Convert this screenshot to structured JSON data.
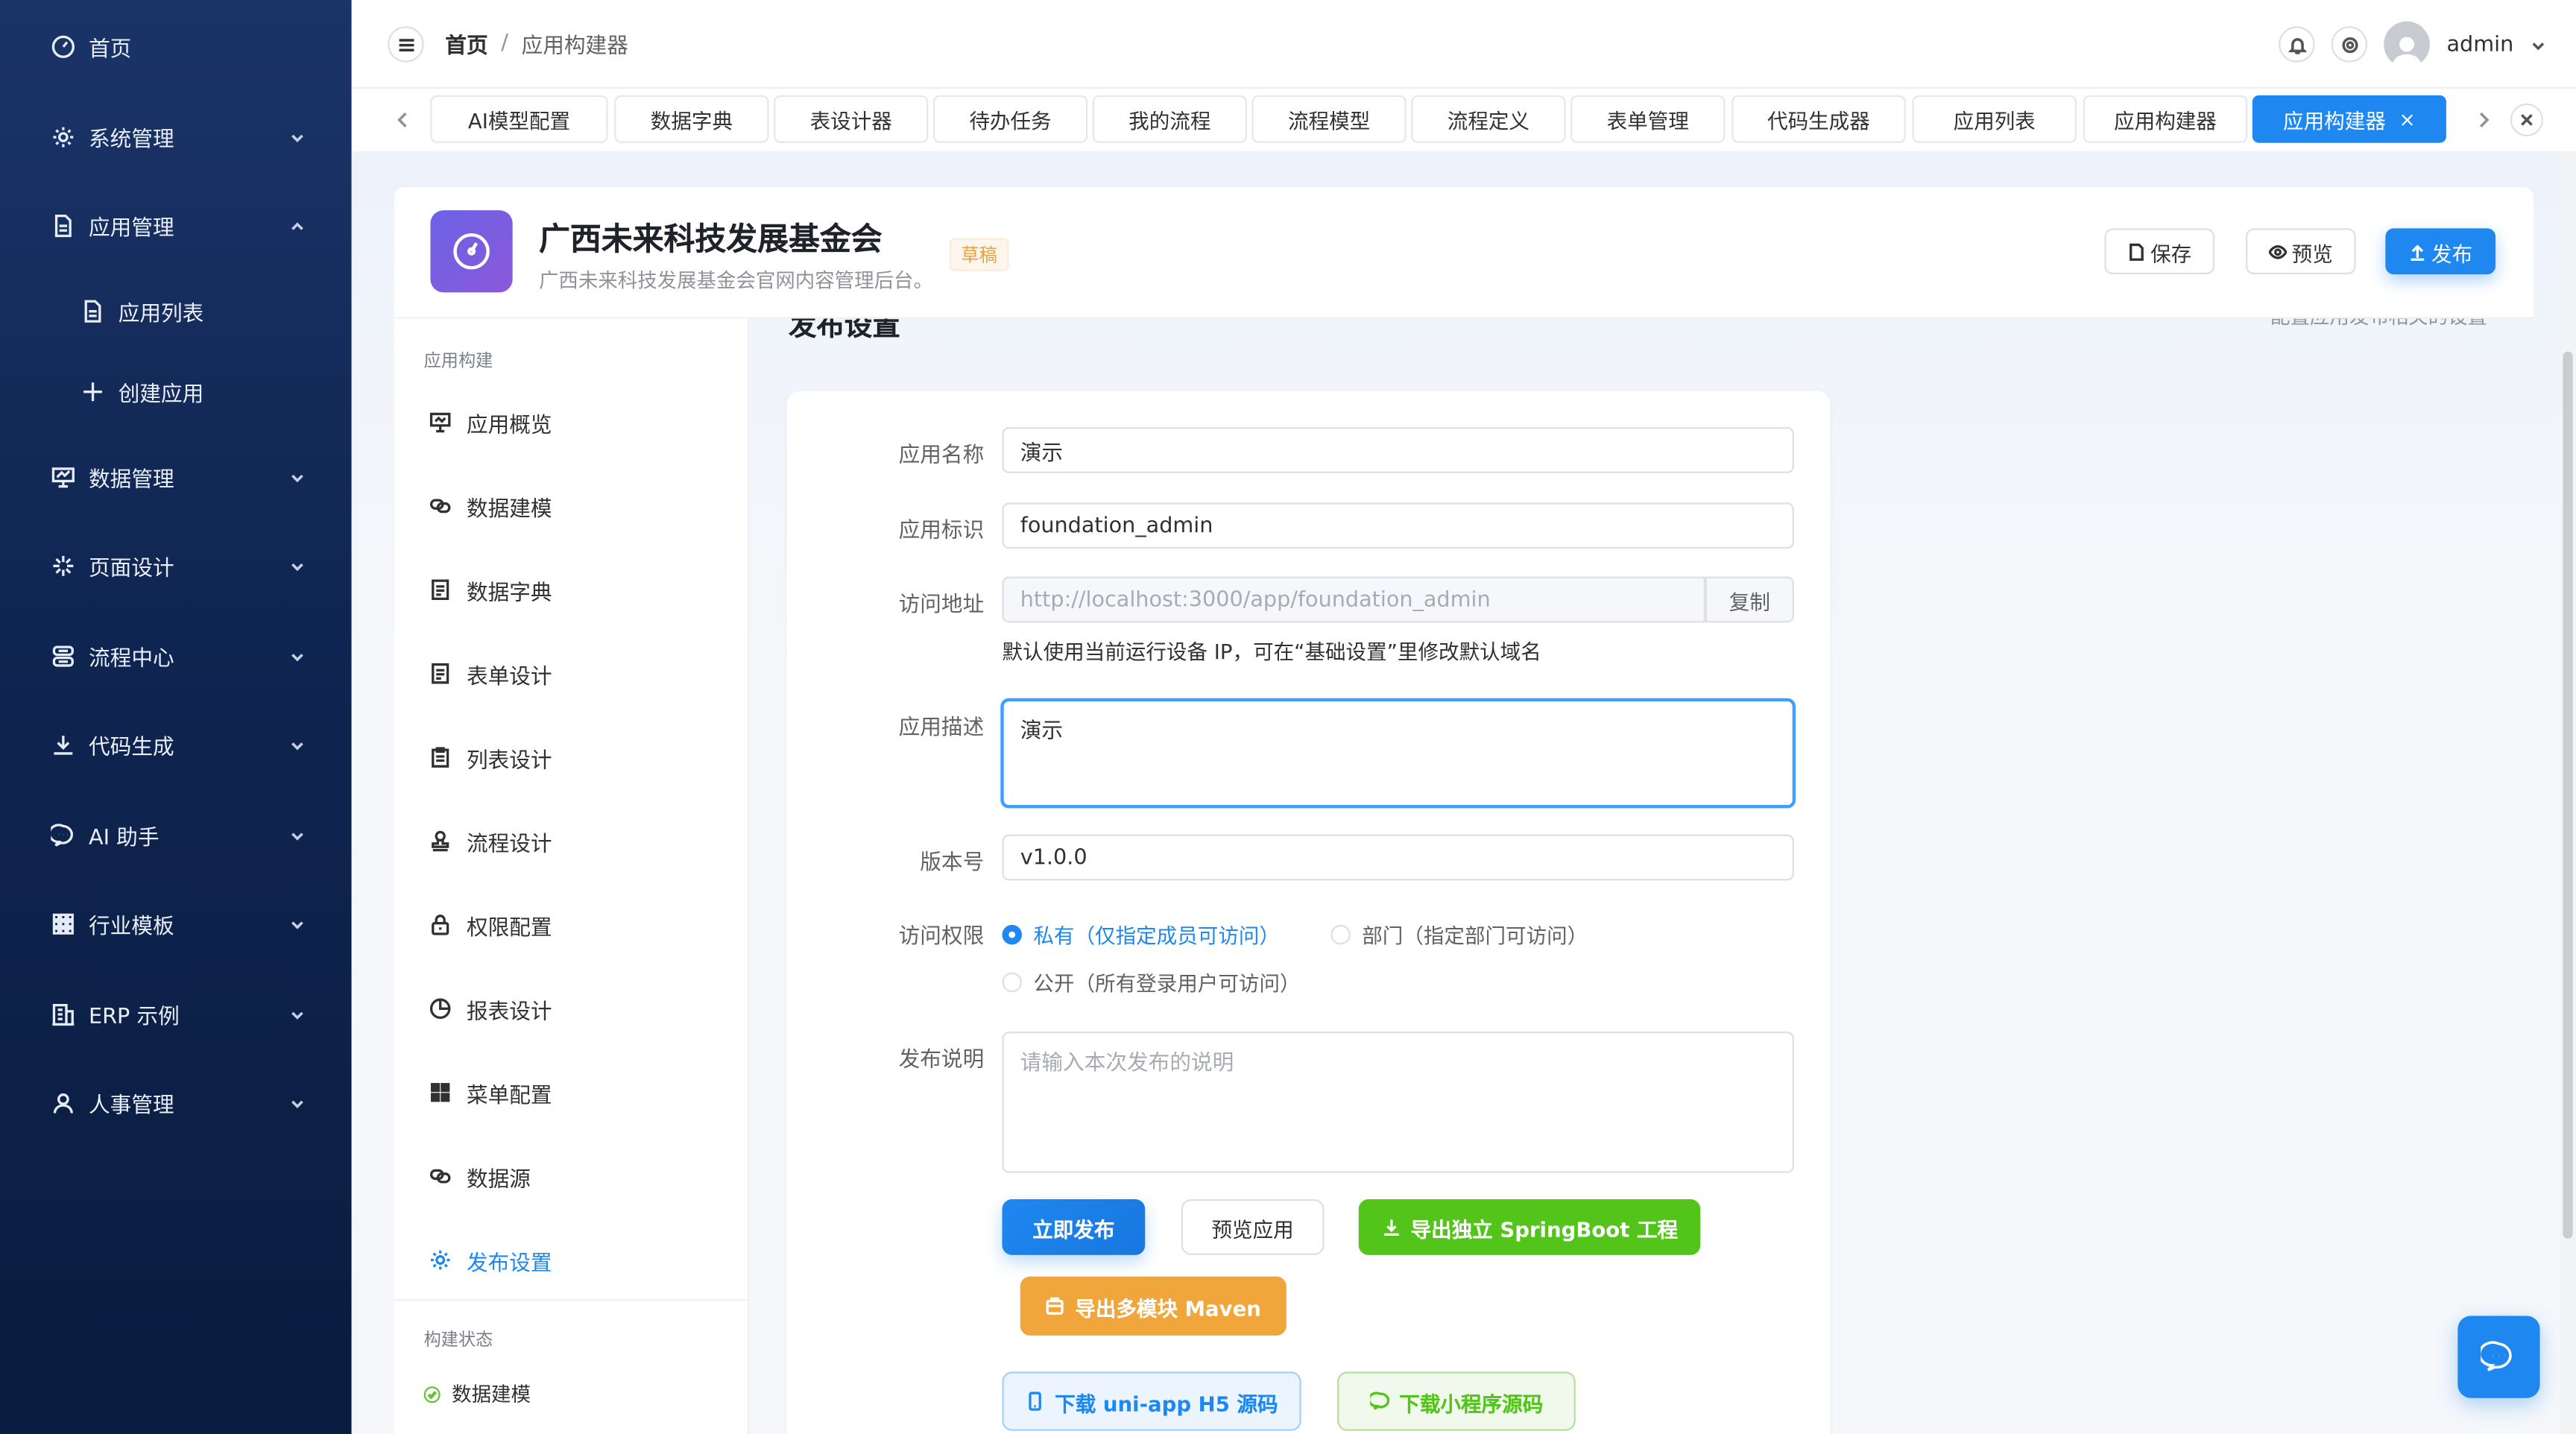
{
  "sidebar": {
    "items": [
      {
        "label": "首页",
        "icon": "dashboard-icon"
      },
      {
        "label": "系统管理",
        "icon": "gear-icon"
      },
      {
        "label": "应用管理",
        "icon": "document-icon"
      },
      {
        "label": "应用列表",
        "icon": "document-icon"
      },
      {
        "label": "创建应用",
        "icon": "plus-icon"
      },
      {
        "label": "数据管理",
        "icon": "chart-board-icon"
      },
      {
        "label": "页面设计",
        "icon": "spark-icon"
      },
      {
        "label": "流程中心",
        "icon": "flow-icon"
      },
      {
        "label": "代码生成",
        "icon": "download-icon"
      },
      {
        "label": "AI 助手",
        "icon": "chat-icon"
      },
      {
        "label": "行业模板",
        "icon": "grid-icon"
      },
      {
        "label": "ERP 示例",
        "icon": "building-icon"
      },
      {
        "label": "人事管理",
        "icon": "user-icon"
      }
    ]
  },
  "header": {
    "breadcrumb_home": "首页",
    "breadcrumb_sep": "/",
    "breadcrumb_current": "应用构建器",
    "username": "admin"
  },
  "tabs": [
    {
      "label": "AI模型配置"
    },
    {
      "label": "数据字典"
    },
    {
      "label": "表设计器"
    },
    {
      "label": "待办任务"
    },
    {
      "label": "我的流程"
    },
    {
      "label": "流程模型"
    },
    {
      "label": "流程定义"
    },
    {
      "label": "表单管理"
    },
    {
      "label": "代码生成器"
    },
    {
      "label": "应用列表"
    },
    {
      "label": "应用构建器"
    },
    {
      "label": "应用构建器",
      "active": true,
      "close": "×"
    }
  ],
  "app": {
    "name": "广西未来科技发展基金会",
    "description": "广西未来科技发展基金会官网内容管理后台。",
    "badge": "草稿",
    "save_label": "保存",
    "preview_label": "预览",
    "publish_label": "发布"
  },
  "builder_nav": {
    "section_label": "应用构建",
    "items": [
      {
        "label": "应用概览",
        "icon": "presentation-icon"
      },
      {
        "label": "数据建模",
        "icon": "link-icon"
      },
      {
        "label": "数据字典",
        "icon": "doc-list-icon"
      },
      {
        "label": "表单设计",
        "icon": "doc-list-icon"
      },
      {
        "label": "列表设计",
        "icon": "clipboard-icon"
      },
      {
        "label": "流程设计",
        "icon": "stamp-icon"
      },
      {
        "label": "权限配置",
        "icon": "lock-icon"
      },
      {
        "label": "报表设计",
        "icon": "pie-icon"
      },
      {
        "label": "菜单配置",
        "icon": "grid-icon"
      },
      {
        "label": "数据源",
        "icon": "link-icon"
      },
      {
        "label": "发布设置",
        "icon": "gear-icon",
        "active": true
      }
    ],
    "status_label": "构建状态",
    "status_items": [
      {
        "label": "数据建模",
        "done": true
      }
    ]
  },
  "page": {
    "title": "发布设置",
    "hint": "配置应用发布相关的设置"
  },
  "form": {
    "name_label": "应用名称",
    "name_value": "演示",
    "code_label": "应用标识",
    "code_value": "foundation_admin",
    "url_label": "访问地址",
    "url_value": "http://localhost:3000/app/foundation_admin",
    "copy_label": "复制",
    "url_help": "默认使用当前运行设备 IP，可在“基础设置”里修改默认域名",
    "desc_label": "应用描述",
    "desc_value": "演示",
    "version_label": "版本号",
    "version_value": "v1.0.0",
    "access_label": "访问权限",
    "access_options": [
      {
        "label": "私有（仅指定成员可访问）",
        "checked": true
      },
      {
        "label": "部门（指定部门可访问）",
        "checked": false
      },
      {
        "label": "公开（所有登录用户可访问）",
        "checked": false
      }
    ],
    "notes_label": "发布说明",
    "notes_placeholder": "请输入本次发布的说明"
  },
  "actions": {
    "publish_now": "立即发布",
    "preview_app": "预览应用",
    "export_springboot": "导出独立 SpringBoot 工程",
    "export_maven": "导出多模块 Maven",
    "download_h5": "下载 uni-app H5 源码",
    "download_mini": "下载小程序源码"
  },
  "colors": {
    "primary": "#1e88f0",
    "sidebar_bg": "#0f2551",
    "green": "#52c41a",
    "orange": "#f0a63b",
    "draft_badge": "#e6a23c"
  }
}
